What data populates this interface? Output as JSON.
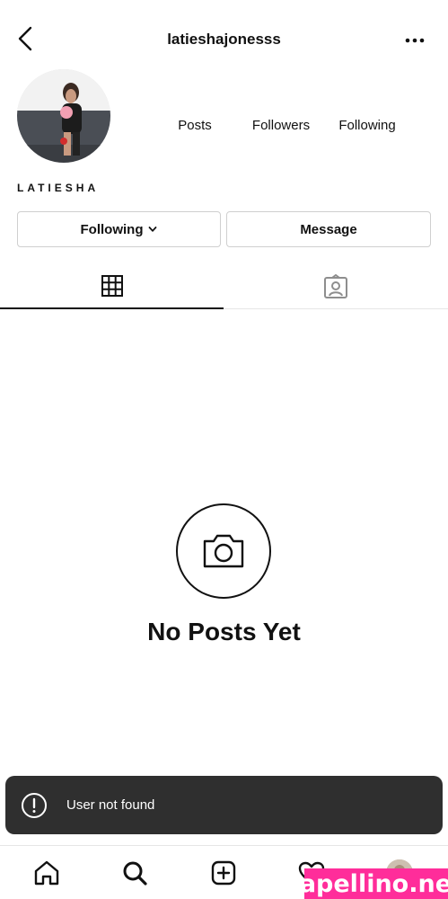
{
  "header": {
    "username": "latieshajonesss"
  },
  "profile": {
    "display_name": "LATIESHA",
    "stats": {
      "posts_label": "Posts",
      "followers_label": "Followers",
      "following_label": "Following"
    }
  },
  "actions": {
    "following_label": "Following",
    "message_label": "Message"
  },
  "tabs": [
    {
      "icon": "grid-icon"
    },
    {
      "icon": "tagged-icon"
    }
  ],
  "empty_state": {
    "title": "No Posts Yet",
    "icon": "camera-icon"
  },
  "toast": {
    "text": "User not found",
    "icon": "alert-icon"
  },
  "bottom_nav": [
    "home-icon",
    "search-icon",
    "new-post-icon",
    "heart-icon",
    "profile-avatar"
  ],
  "watermark": {
    "text": "fapellino.net"
  },
  "colors": {
    "toast_bg": "#2f2f2f",
    "watermark_bg": "#ff2d9a",
    "text": "#111111"
  }
}
